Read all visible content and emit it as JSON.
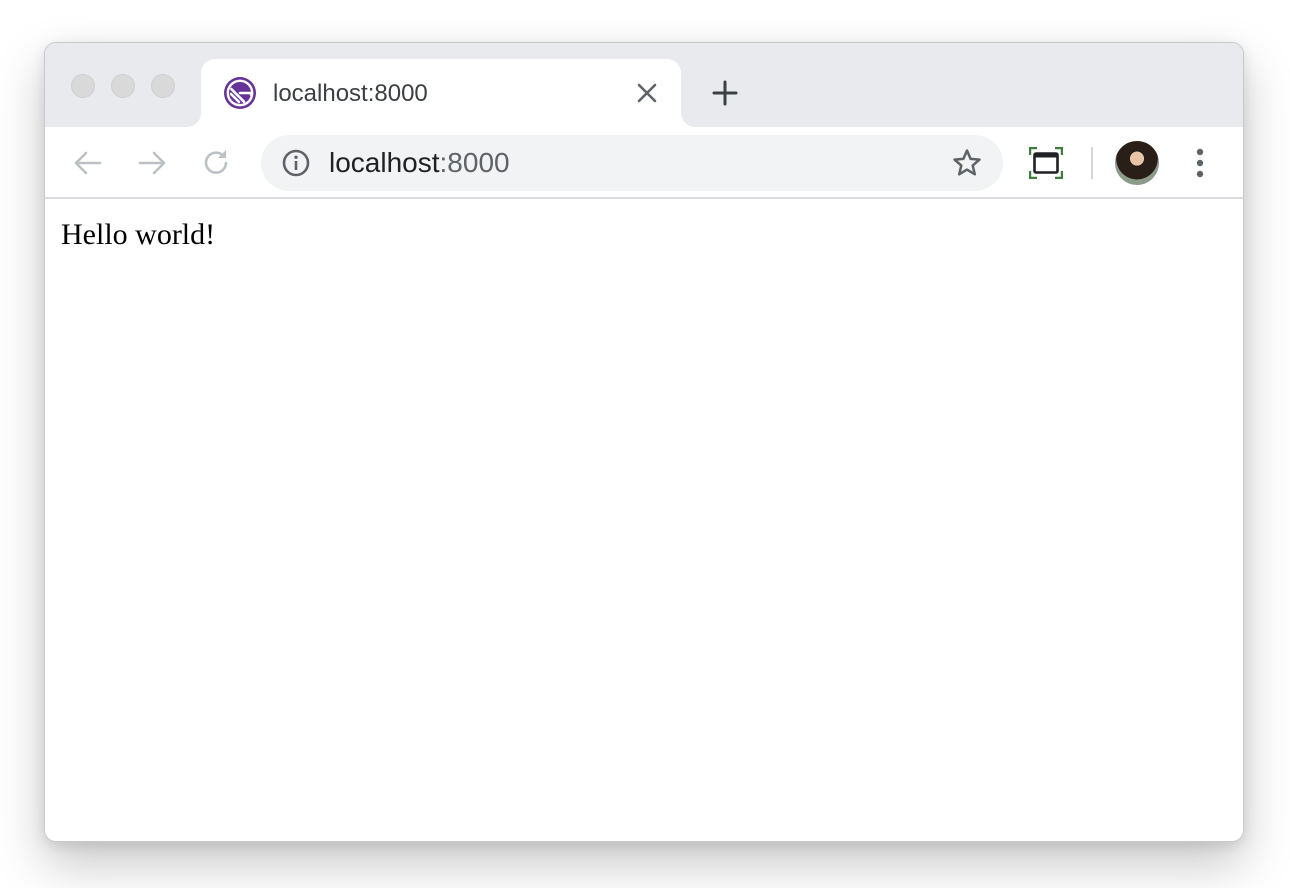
{
  "browser": {
    "tab": {
      "title": "localhost:8000",
      "favicon_icon": "gatsby-logo-icon",
      "favicon_color": "#663399"
    },
    "omnibox": {
      "host": "localhost",
      "port": ":8000"
    },
    "accent_colors": {
      "tabstrip": "#e8eaed",
      "omnibox": "#f1f3f4",
      "extension_frame": "#3d7d3d"
    },
    "icons": {
      "back": "back-arrow-icon",
      "forward": "forward-arrow-icon",
      "reload": "reload-icon",
      "info": "info-icon",
      "bookmark": "star-icon",
      "extension": "window-extension-icon",
      "profile": "profile-avatar",
      "menu": "kebab-menu-icon",
      "close": "close-icon",
      "new_tab": "plus-icon"
    }
  },
  "page": {
    "body_text": "Hello world!"
  }
}
